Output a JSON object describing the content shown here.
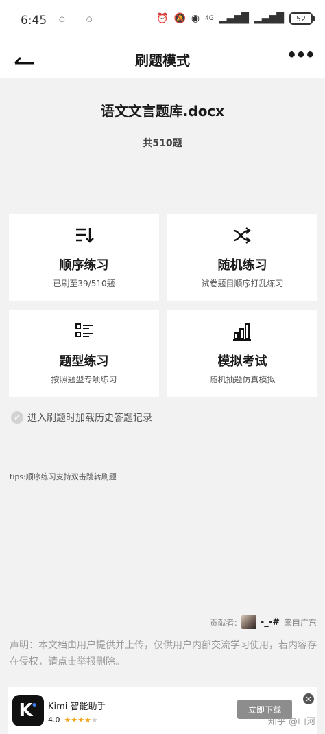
{
  "status_bar": {
    "time": "6:45",
    "dots": "○ ○",
    "network": "4G",
    "battery": "52"
  },
  "header": {
    "back_icon": "back-arrow-icon",
    "title": "刷题模式",
    "more_icon": "more-horizontal-icon"
  },
  "doc": {
    "title": "语文文言题库.docx",
    "count": "共510题"
  },
  "modes": [
    {
      "icon": "sort-order-icon",
      "title": "顺序练习",
      "subtitle": "已刷至39/510题"
    },
    {
      "icon": "shuffle-icon",
      "title": "随机练习",
      "subtitle": "试卷题目顺序打乱练习"
    },
    {
      "icon": "question-type-list-icon",
      "title": "题型练习",
      "subtitle": "按照题型专项练习"
    },
    {
      "icon": "bar-chart-icon",
      "title": "模拟考试",
      "subtitle": "随机抽题仿真模拟"
    }
  ],
  "history_option": {
    "label": "进入刷题时加载历史答题记录",
    "checked": false
  },
  "tips": "tips:顺序练习支持双击跳转刷题",
  "contributor": {
    "label": "贡献者:",
    "name": "-_-#",
    "location": "来自广东"
  },
  "statement": "声明：本文档由用户提供并上传，仅供用户内部交流学习使用，若内容存在侵权，请点击举报删除。",
  "ad": {
    "app_name": "Kimi 智能助手",
    "rating": "4.0",
    "download_label": "立即下载",
    "close_icon": "close-icon",
    "watermark": "知乎 @山河"
  }
}
